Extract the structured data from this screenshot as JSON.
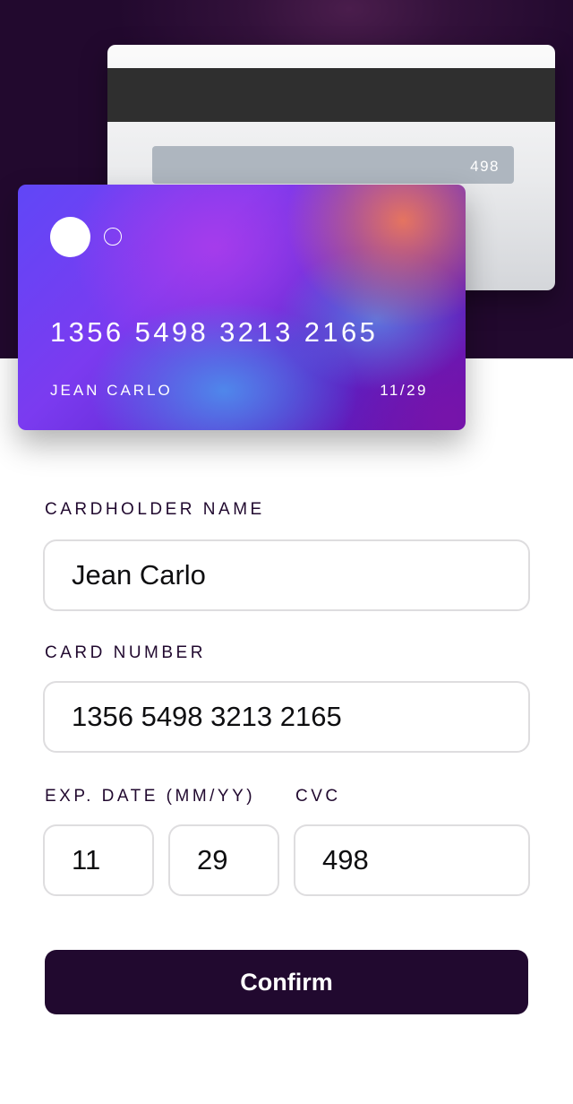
{
  "card_back": {
    "cvc": "498"
  },
  "card_front": {
    "number": "1356 5498 3213 2165",
    "holder": "JEAN CARLO",
    "expiry": "11/29"
  },
  "form": {
    "name_label": "CARDHOLDER NAME",
    "name_value": "Jean Carlo",
    "number_label": "CARD NUMBER",
    "number_value": "1356 5498 3213 2165",
    "exp_label": "EXP. DATE (MM/YY)",
    "month_value": "11",
    "year_value": "29",
    "cvc_label": "CVC",
    "cvc_value": "498",
    "confirm_label": "Confirm"
  },
  "colors": {
    "hero_background": "#22092e",
    "primary_dark": "#21092f",
    "input_border": "#dedddf"
  }
}
